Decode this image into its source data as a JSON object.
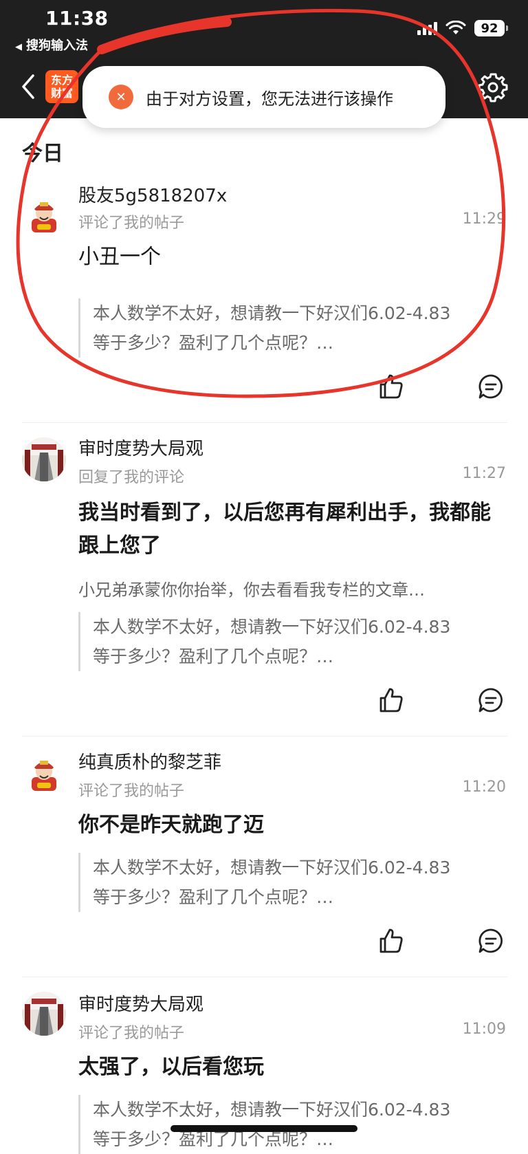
{
  "status": {
    "time": "11:38",
    "back_app": "搜狗输入法",
    "battery": "92"
  },
  "header": {
    "logo_line1": "东方",
    "logo_line2": "财富"
  },
  "toast": {
    "message": "由于对方设置，您无法进行该操作"
  },
  "section": {
    "title": "今日"
  },
  "messages": [
    {
      "user": "股友5g5818207x",
      "action": "评论了我的帖子",
      "time": "11:29",
      "content": "小丑一个",
      "reply": "",
      "quote_line1": "本人数学不太好，想请教一下好汉们6.02-4.83",
      "quote_line2": "等于多少？盈利了几个点呢？…"
    },
    {
      "user": "审时度势大局观",
      "action": "回复了我的评论",
      "time": "11:27",
      "content": "我当时看到了，以后您再有犀利出手，我都能跟上您了",
      "reply": "小兄弟承蒙你你抬举，你去看看我专栏的文章…",
      "quote_line1": "本人数学不太好，想请教一下好汉们6.02-4.83",
      "quote_line2": "等于多少？盈利了几个点呢？…"
    },
    {
      "user": "纯真质朴的黎芝菲",
      "action": "评论了我的帖子",
      "time": "11:20",
      "content": "你不是昨天就跑了迈",
      "reply": "",
      "quote_line1": "本人数学不太好，想请教一下好汉们6.02-4.83",
      "quote_line2": "等于多少？盈利了几个点呢？…"
    },
    {
      "user": "审时度势大局观",
      "action": "评论了我的帖子",
      "time": "11:09",
      "content": "太强了，以后看您玩",
      "reply": "",
      "quote_line1": "本人数学不太好，想请教一下好汉们6.02-4.83",
      "quote_line2": "等于多少？盈利了几个点呢？…"
    }
  ],
  "colors": {
    "topbar": "#1f1f1f",
    "brand": "#ff5a1f",
    "toast_icon": "#f06a3c",
    "annotation_ink": "#e8352b"
  }
}
